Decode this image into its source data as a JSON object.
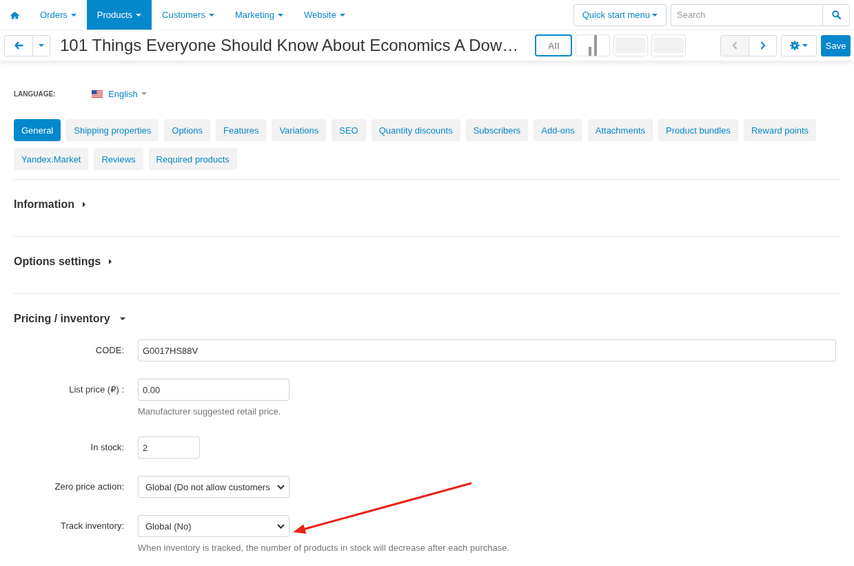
{
  "top_nav": {
    "items": [
      {
        "kind": "home",
        "selected": false
      },
      {
        "kind": "menu",
        "label": "Orders",
        "selected": false
      },
      {
        "kind": "menu",
        "label": "Products",
        "selected": true
      },
      {
        "kind": "menu",
        "label": "Customers",
        "selected": false
      },
      {
        "kind": "menu",
        "label": "Marketing",
        "selected": false
      },
      {
        "kind": "menu",
        "label": "Website",
        "selected": false
      }
    ],
    "quick_start": "Quick start menu",
    "search": {
      "placeholder": "Search"
    }
  },
  "header": {
    "title": "101 Things Everyone Should Know About Economics A Dow…",
    "thumbnails": [
      {
        "kind": "all",
        "label": "All",
        "selected": true
      },
      {
        "kind": "chart",
        "selected": false
      },
      {
        "kind": "image",
        "selected": false
      },
      {
        "kind": "image",
        "selected": false
      }
    ],
    "pager": [
      {
        "kind": "prev",
        "disabled": true
      },
      {
        "kind": "next",
        "disabled": false
      }
    ],
    "save": "Save"
  },
  "language": {
    "label": "LANGUAGE:",
    "value": "English"
  },
  "tabs": [
    {
      "label": "General",
      "selected": true
    },
    {
      "label": "Shipping properties",
      "selected": false
    },
    {
      "label": "Options",
      "selected": false
    },
    {
      "label": "Features",
      "selected": false
    },
    {
      "label": "Variations",
      "selected": false
    },
    {
      "label": "SEO",
      "selected": false
    },
    {
      "label": "Quantity discounts",
      "selected": false
    },
    {
      "label": "Subscribers",
      "selected": false
    },
    {
      "label": "Add-ons",
      "selected": false
    },
    {
      "label": "Attachments",
      "selected": false
    },
    {
      "label": "Product bundles",
      "selected": false
    },
    {
      "label": "Reward points",
      "selected": false
    },
    {
      "label": "Yandex.Market",
      "selected": false
    },
    {
      "label": "Reviews",
      "selected": false
    },
    {
      "label": "Required products",
      "selected": false
    }
  ],
  "sections": [
    {
      "title": "Information",
      "expanded": false
    },
    {
      "title": "Options settings",
      "expanded": false
    },
    {
      "title": "Pricing / inventory",
      "expanded": true,
      "fields": [
        {
          "kind": "text",
          "label": "CODE:",
          "value": "G0017HS88V"
        },
        {
          "kind": "text",
          "label": "List price (₽) :",
          "value": "0.00",
          "help": "Manufacturer suggested retail price."
        },
        {
          "kind": "text",
          "label": "In stock:",
          "value": "2"
        },
        {
          "kind": "select",
          "label": "Zero price action:",
          "value": "Global (Do not allow customers"
        },
        {
          "kind": "select",
          "label": "Track inventory:",
          "value": "Global (No)",
          "help": "When inventory is tracked, the number of products in stock will decrease after each purchase."
        }
      ]
    }
  ],
  "annotations": [
    {
      "kind": "arrow"
    }
  ]
}
